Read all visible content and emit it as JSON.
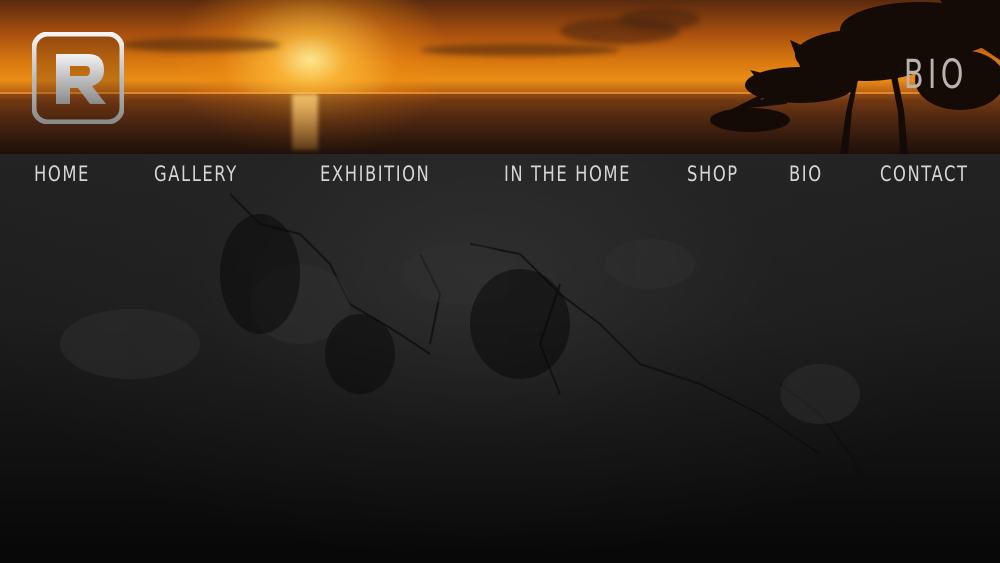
{
  "header": {
    "page_heading": "BIO",
    "logo_alt": "R logo",
    "logo_icon": "r-logo-icon",
    "colors": {
      "sky": "#d9780f",
      "sun": "#ffe9a0",
      "heading": "#b9b2ad"
    }
  },
  "nav": {
    "items": [
      {
        "label": "HOME"
      },
      {
        "label": "GALLERY"
      },
      {
        "label": "EXHIBITION"
      },
      {
        "label": "IN THE HOME"
      },
      {
        "label": "SHOP"
      },
      {
        "label": "BIO"
      },
      {
        "label": "CONTACT"
      }
    ],
    "text_color": "#d6d6d6"
  },
  "content": {
    "background": "dark stone texture",
    "color": "#1d1d1d"
  }
}
